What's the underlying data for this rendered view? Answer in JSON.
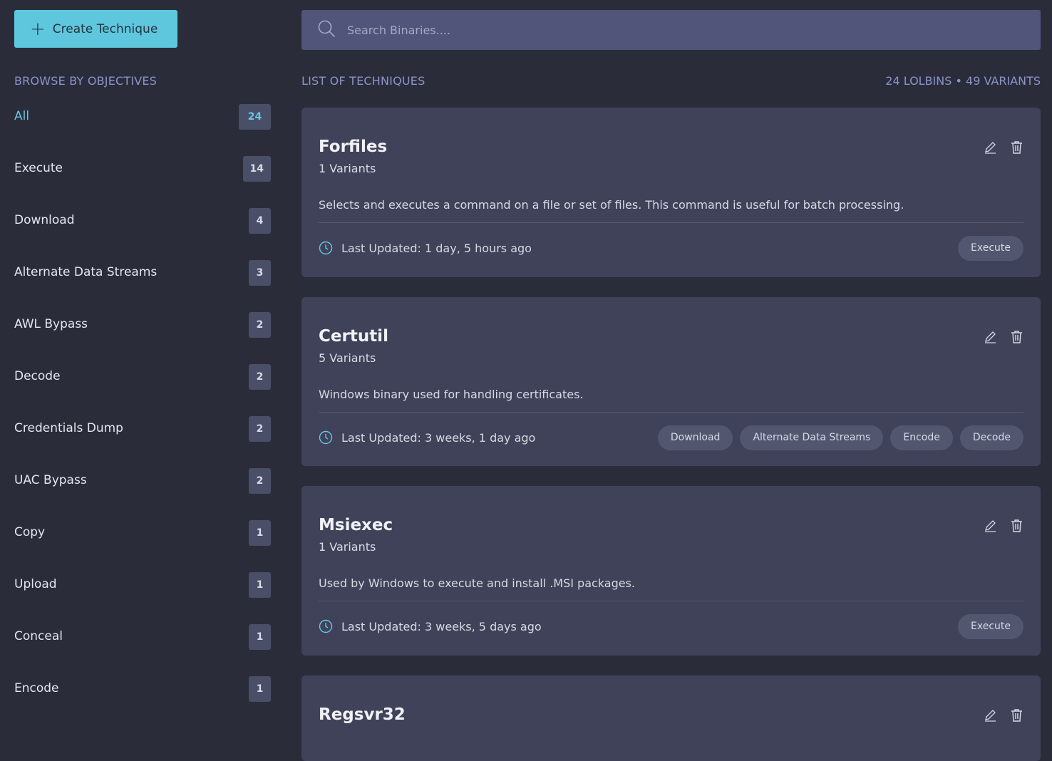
{
  "sidebar": {
    "create_label": "Create Technique",
    "section_title": "BROWSE BY OBJECTIVES",
    "items": [
      {
        "label": "All",
        "count": "24"
      },
      {
        "label": "Execute",
        "count": "14"
      },
      {
        "label": "Download",
        "count": "4"
      },
      {
        "label": "Alternate Data Streams",
        "count": "3"
      },
      {
        "label": "AWL Bypass",
        "count": "2"
      },
      {
        "label": "Decode",
        "count": "2"
      },
      {
        "label": "Credentials Dump",
        "count": "2"
      },
      {
        "label": "UAC Bypass",
        "count": "2"
      },
      {
        "label": "Copy",
        "count": "1"
      },
      {
        "label": "Upload",
        "count": "1"
      },
      {
        "label": "Conceal",
        "count": "1"
      },
      {
        "label": "Encode",
        "count": "1"
      }
    ]
  },
  "search": {
    "placeholder": "Search Binaries...."
  },
  "list": {
    "title": "LIST OF TECHNIQUES",
    "stats": "24 LOLBINS • 49 VARIANTS",
    "cards": [
      {
        "title": "Forfiles",
        "variants": "1 Variants",
        "description": "Selects and executes a command on a file or set of files. This command is useful for batch processing.",
        "updated": "Last Updated: 1 day, 5 hours ago",
        "tags": [
          "Execute"
        ]
      },
      {
        "title": "Certutil",
        "variants": "5 Variants",
        "description": "Windows binary used for handling certificates.",
        "updated": "Last Updated: 3 weeks, 1 day ago",
        "tags": [
          "Download",
          "Alternate Data Streams",
          "Encode",
          "Decode"
        ]
      },
      {
        "title": "Msiexec",
        "variants": "1 Variants",
        "description": "Used by Windows to execute and install .MSI packages.",
        "updated": "Last Updated: 3 weeks, 5 days ago",
        "tags": [
          "Execute"
        ]
      },
      {
        "title": "Regsvr32"
      }
    ]
  },
  "colors": {
    "background": "#2b2c3a",
    "accent": "#5ec7dd",
    "card": "#3f4259",
    "tag": "#52566f"
  }
}
